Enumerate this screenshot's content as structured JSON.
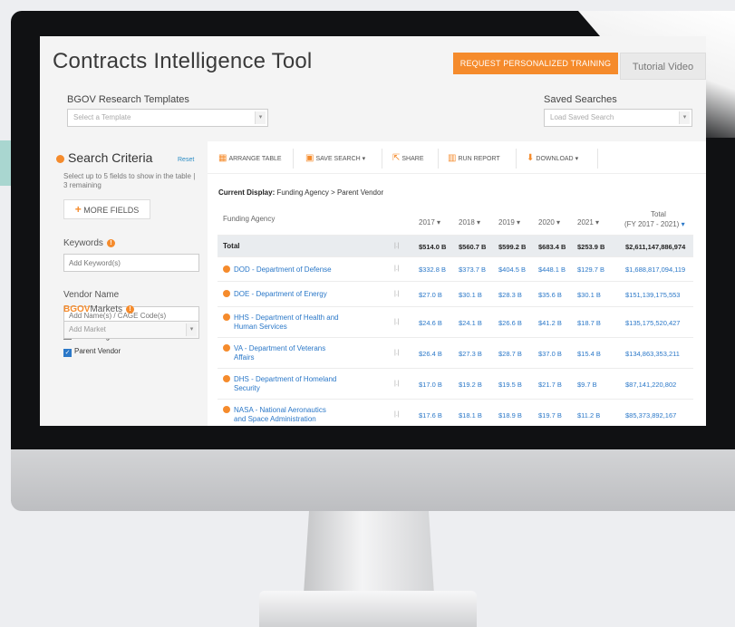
{
  "header": {
    "title": "Contracts Intelligence Tool",
    "training_button": "REQUEST PERSONALIZED TRAINING",
    "video_button": "Tutorial Video"
  },
  "templates": {
    "label": "BGOV Research Templates",
    "placeholder": "Select a Template"
  },
  "saved": {
    "label": "Saved Searches",
    "placeholder": "Load Saved Search"
  },
  "sidebar": {
    "title": "Search Criteria",
    "reset": "Reset",
    "hint": "Select up to 5 fields to show in the table | 3 remaining",
    "more_fields": "MORE FIELDS",
    "keywords_label": "Keywords",
    "keywords_placeholder": "Add Keyword(s)",
    "vendor_label": "Vendor Name",
    "vendor_placeholder": "Add Name(s) / CAGE Code(s)",
    "performing_vendor": "Performing Vendor",
    "parent_vendor": "Parent Vendor",
    "markets_brand": "BGOV",
    "markets_label": "Markets",
    "markets_placeholder": "Add Market"
  },
  "toolbar": {
    "arrange": "ARRANGE TABLE",
    "save": "SAVE SEARCH",
    "share": "SHARE",
    "run": "RUN REPORT",
    "download": "DOWNLOAD"
  },
  "current": {
    "label": "Current Display:",
    "value": "Funding Agency > Parent Vendor"
  },
  "table": {
    "columns": [
      "Funding Agency",
      "2017",
      "2018",
      "2019",
      "2020",
      "2021",
      "Total",
      "(FY 2017 - 2021)"
    ],
    "total_row": {
      "name": "Total",
      "values": [
        "$514.0 B",
        "$560.7 B",
        "$599.2 B",
        "$683.4 B",
        "$253.9 B",
        "$2,611,147,886,974"
      ]
    },
    "rows": [
      {
        "name1": "DOD - Department of Defense",
        "name2": "",
        "values": [
          "$332.8 B",
          "$373.7 B",
          "$404.5 B",
          "$448.1 B",
          "$129.7 B",
          "$1,688,817,094,119"
        ]
      },
      {
        "name1": "DOE - Department of Energy",
        "name2": "",
        "values": [
          "$27.0 B",
          "$30.1 B",
          "$28.3 B",
          "$35.6 B",
          "$30.1 B",
          "$151,139,175,553"
        ]
      },
      {
        "name1": "HHS - Department of Health and",
        "name2": "Human Services",
        "values": [
          "$24.6 B",
          "$24.1 B",
          "$26.6 B",
          "$41.2 B",
          "$18.7 B",
          "$135,175,520,427"
        ]
      },
      {
        "name1": "VA - Department of Veterans",
        "name2": "Affairs",
        "values": [
          "$26.4 B",
          "$27.3 B",
          "$28.7 B",
          "$37.0 B",
          "$15.4 B",
          "$134,863,353,211"
        ]
      },
      {
        "name1": "DHS - Department of Homeland",
        "name2": "Security",
        "values": [
          "$17.0 B",
          "$19.2 B",
          "$19.5 B",
          "$21.7 B",
          "$9.7 B",
          "$87,141,220,802"
        ]
      },
      {
        "name1": "NASA - National Aeronautics",
        "name2": "and Space Administration",
        "values": [
          "$17.6 B",
          "$18.1 B",
          "$18.9 B",
          "$19.7 B",
          "$11.2 B",
          "$85,373,892,167"
        ]
      }
    ]
  }
}
